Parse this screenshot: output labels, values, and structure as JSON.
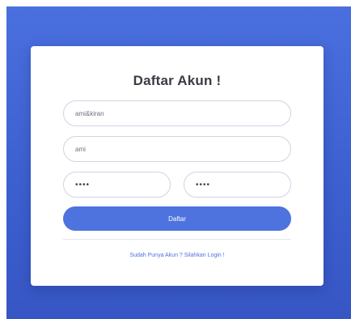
{
  "page": {
    "title": "Daftar Akun !",
    "colors": {
      "background": "#4a6fde",
      "card": "#ffffff",
      "accent": "#4e73df",
      "title_text": "#3a3b45"
    }
  },
  "form": {
    "username_value": "ami&kiran",
    "name_value": "ami",
    "password_value": "••••",
    "password_repeat_value": "••••",
    "submit_label": "Daftar"
  },
  "footer": {
    "login_link": "Sudah Punya Akun ? Silahkan Login !"
  }
}
